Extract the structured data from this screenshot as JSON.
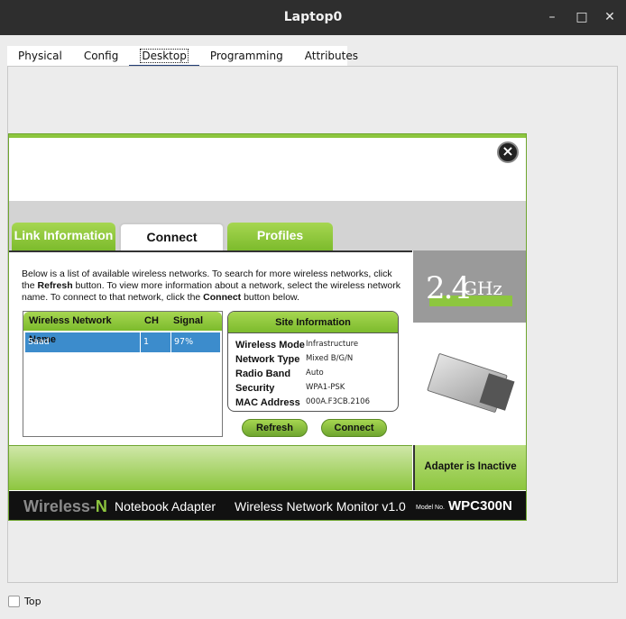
{
  "window": {
    "title": "Laptop0",
    "minimize": "–",
    "maximize": "□",
    "close": "✕"
  },
  "tabs": [
    "Physical",
    "Config",
    "Desktop",
    "Programming",
    "Attributes"
  ],
  "active_tab": "Desktop",
  "app": {
    "tabs": [
      "Link Information",
      "Connect",
      "Profiles"
    ],
    "active_tab": "Connect",
    "description": {
      "p1": "Below is a list of available wireless networks. To search for more wireless networks, click the ",
      "refresh": "Refresh",
      "p2": " button. To view more information about a network, select the wireless network name. To connect to that network, click the ",
      "connect": "Connect",
      "p3": " button below."
    },
    "network_list": {
      "headers": [
        "Wireless Network Name",
        "CH",
        "Signal"
      ],
      "rows": [
        {
          "name": "Saad",
          "ch": "1",
          "signal": "97%"
        }
      ]
    },
    "site_info": {
      "title": "Site Information",
      "rows": [
        {
          "label": "Wireless Mode",
          "value": "Infrastructure"
        },
        {
          "label": "Network Type",
          "value": "Mixed B/G/N"
        },
        {
          "label": "Radio Band",
          "value": "Auto"
        },
        {
          "label": "Security",
          "value": "WPA1-PSK"
        },
        {
          "label": "MAC Address",
          "value": "000A.F3CB.2106"
        }
      ]
    },
    "buttons": {
      "refresh": "Refresh",
      "connect": "Connect"
    },
    "frequency": {
      "number": "2.4",
      "unit": "GHz"
    },
    "status": "Adapter is Inactive",
    "footer": {
      "brand_a": "Wireless-",
      "brand_b": "N",
      "adapter": "Notebook Adapter",
      "monitor": "Wireless Network Monitor  v1.0",
      "model_label": "Model No.",
      "model": "WPC300N"
    }
  },
  "top_checkbox": {
    "label": "Top",
    "checked": false
  }
}
